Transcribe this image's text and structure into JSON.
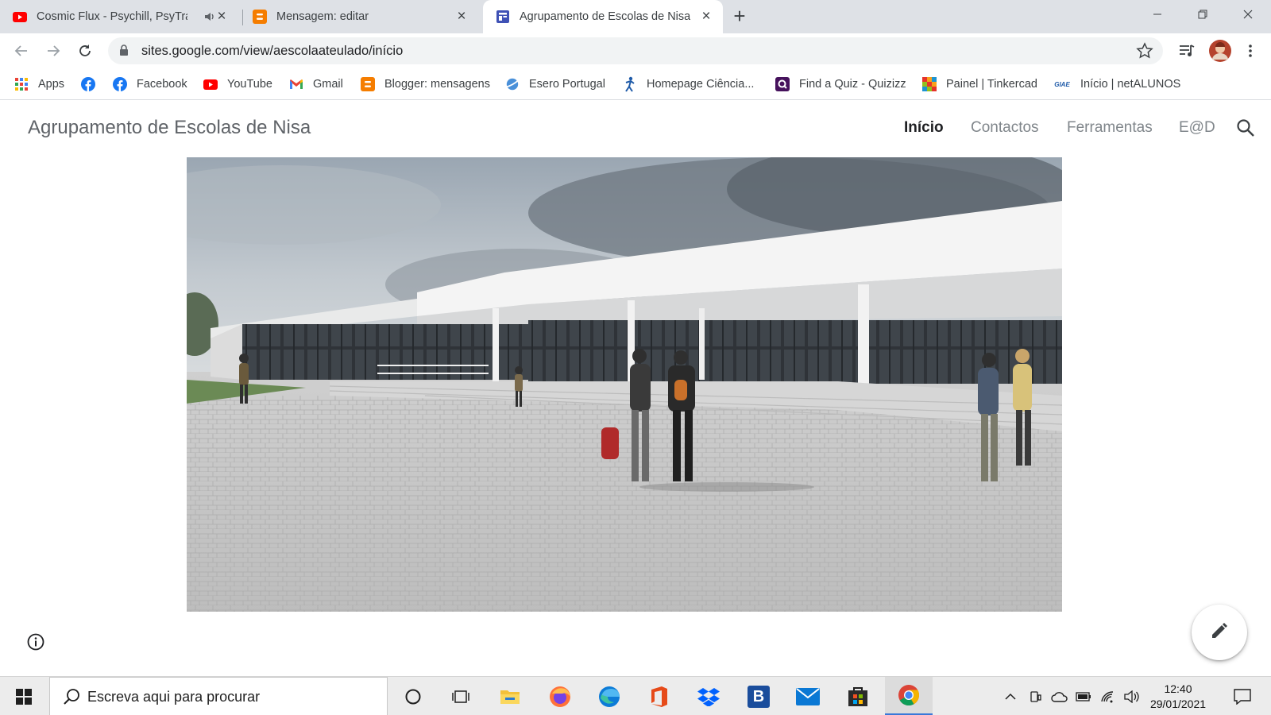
{
  "browser": {
    "tabs": [
      {
        "title": "Cosmic Flux - Psychill, PsyTra",
        "favicon": "youtube-icon",
        "audio": true,
        "active": false
      },
      {
        "title": "Mensagem: editar",
        "favicon": "blogger-icon",
        "active": false
      },
      {
        "title": "Agrupamento de Escolas de Nisa",
        "favicon": "google-sites-icon",
        "active": true
      }
    ],
    "address_bar": {
      "url": "sites.google.com/view/aescolaateulado/início"
    },
    "bookmarks": [
      {
        "label": "Apps",
        "icon": "apps-grid-icon"
      },
      {
        "label": "",
        "icon": "facebook-icon"
      },
      {
        "label": "Facebook",
        "icon": "facebook-icon"
      },
      {
        "label": "YouTube",
        "icon": "youtube-icon"
      },
      {
        "label": "Gmail",
        "icon": "gmail-icon"
      },
      {
        "label": "Blogger: mensagens",
        "icon": "blogger-icon"
      },
      {
        "label": "Esero Portugal",
        "icon": "esero-icon"
      },
      {
        "label": "Homepage Ciência...",
        "icon": "ciencia-icon"
      },
      {
        "label": "Find a Quiz - Quizizz",
        "icon": "quizizz-icon"
      },
      {
        "label": "Painel | Tinkercad",
        "icon": "tinkercad-icon"
      },
      {
        "label": "Início | netALUNOS",
        "icon": "giae-icon",
        "icon_text": "GIAE"
      }
    ]
  },
  "site": {
    "title": "Agrupamento de Escolas de Nisa",
    "nav": [
      {
        "label": "Início",
        "active": true
      },
      {
        "label": "Contactos",
        "active": false
      },
      {
        "label": "Ferramentas",
        "active": false
      },
      {
        "label": "E@D",
        "active": false
      }
    ],
    "hero_image": "school-building-rendering"
  },
  "taskbar": {
    "search_placeholder": "Escreva aqui para procurar",
    "apps": [
      "cortana-icon",
      "task-view-icon",
      "file-explorer-icon",
      "firefox-icon",
      "edge-icon",
      "office-icon",
      "dropbox-icon",
      "b-app-icon",
      "mail-icon",
      "store-icon",
      "chrome-icon"
    ],
    "b_app_letter": "B",
    "time": "12:40",
    "date": "29/01/2021"
  },
  "colors": {
    "tabstrip": "#dee1e6",
    "accent": "#1a73e8",
    "taskbar": "#ececec"
  }
}
